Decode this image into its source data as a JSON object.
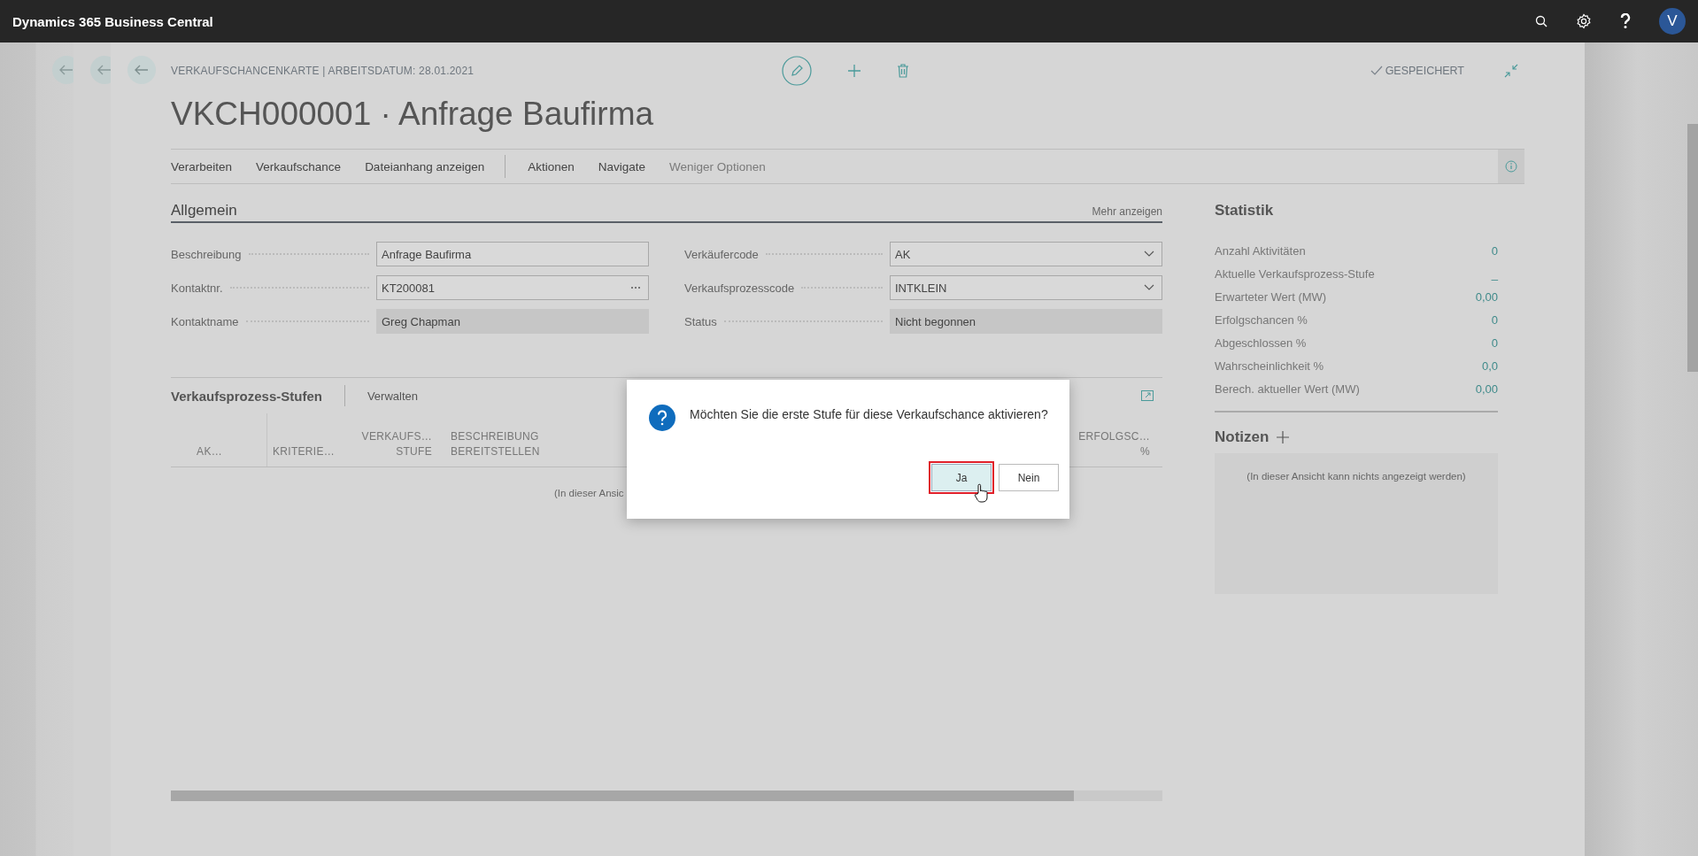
{
  "app_bar": {
    "title": "Dynamics 365 Business Central",
    "avatar": "V"
  },
  "page": {
    "breadcrumb": "VERKAUFSCHANCENKARTE | ARBEITSDATUM: 28.01.2021",
    "title": "VKCH000001 · Anfrage Baufirma",
    "save_status": "GESPEICHERT"
  },
  "action_groups": [
    [
      {
        "label": "Verarbeiten",
        "kind": "menu"
      },
      {
        "label": "Verkaufschance",
        "kind": "menu"
      },
      {
        "label": "Dateianhang anzeigen",
        "kind": "menu"
      }
    ],
    [
      {
        "label": "Aktionen",
        "kind": "menu"
      },
      {
        "label": "Navigate",
        "kind": "menu"
      },
      {
        "label": "Weniger Optionen",
        "kind": "toggle"
      }
    ]
  ],
  "general": {
    "title": "Allgemein",
    "more": "Mehr anzeigen",
    "columns": [
      [
        {
          "label": "Beschreibung",
          "value": "Anfrage Baufirma",
          "kind": "text"
        },
        {
          "label": "Kontaktnr.",
          "value": "KT200081",
          "kind": "lookup"
        },
        {
          "label": "Kontaktname",
          "value": "Greg Chapman",
          "kind": "readonly"
        }
      ],
      [
        {
          "label": "Verkäufercode",
          "value": "AK",
          "kind": "dropdown"
        },
        {
          "label": "Verkaufsprozesscode",
          "value": "INTKLEIN",
          "kind": "dropdown"
        },
        {
          "label": "Status",
          "value": "Nicht begonnen",
          "kind": "readonly"
        }
      ]
    ]
  },
  "lines": {
    "title": "Verkaufsprozess-Stufen",
    "manage": "Verwalten",
    "columns": [
      {
        "lines": [
          "AK…"
        ]
      },
      {
        "lines": [
          "KRITERIE…"
        ]
      },
      {
        "lines": [
          "VERKAUFS…",
          "STUFE"
        ]
      },
      {
        "lines": [
          "BESCHREIBUNG",
          "BEREITSTELLEN"
        ]
      },
      {
        "lines": [
          "ERFOLGSC…",
          "%"
        ]
      }
    ],
    "empty": "(In dieser Ansic"
  },
  "statistics": {
    "title": "Statistik",
    "rows": [
      {
        "label": "Anzahl Aktivitäten",
        "value": "0"
      },
      {
        "label": "Aktuelle Verkaufsprozess-Stufe",
        "value": "_"
      },
      {
        "label": "Erwarteter Wert (MW)",
        "value": "0,00"
      },
      {
        "label": "Erfolgschancen %",
        "value": "0"
      },
      {
        "label": "Abgeschlossen %",
        "value": "0"
      },
      {
        "label": "Wahrscheinlichkeit %",
        "value": "0,0"
      },
      {
        "label": "Berech. aktueller Wert (MW)",
        "value": "0,00"
      }
    ]
  },
  "notes": {
    "title": "Notizen",
    "empty": "(In dieser Ansicht kann nichts angezeigt werden)"
  },
  "dialog": {
    "message": "Möchten Sie die erste Stufe für diese Verkaufschance aktivieren?",
    "buttons": [
      {
        "label": "Ja",
        "selected": true
      },
      {
        "label": "Nein",
        "selected": false
      }
    ]
  }
}
